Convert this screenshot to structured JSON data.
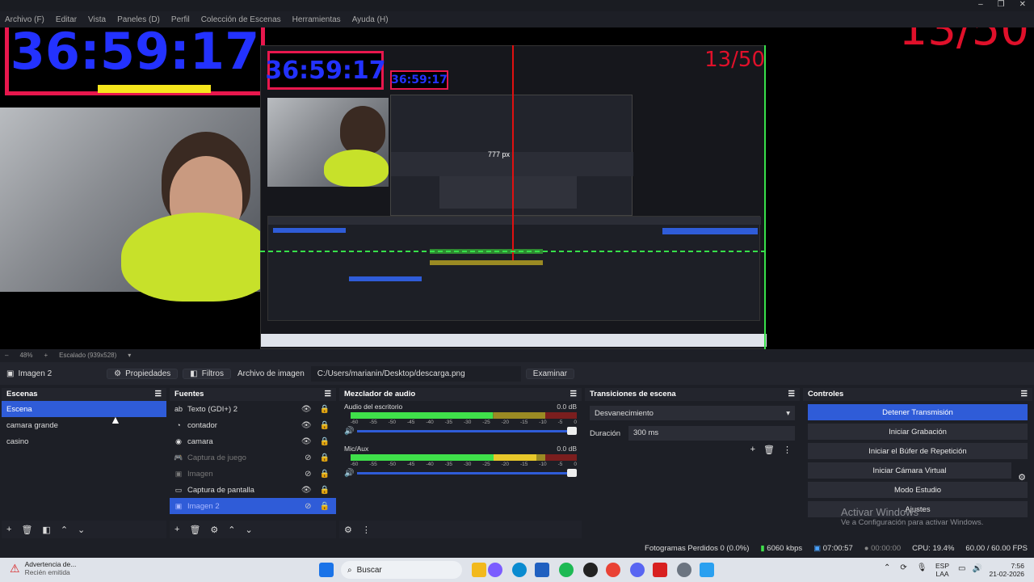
{
  "window": {
    "controls": [
      "–",
      "❐",
      "✕"
    ]
  },
  "menu": [
    "Archivo (F)",
    "Editar",
    "Vista",
    "Paneles (D)",
    "Perfil",
    "Colección de Escenas",
    "Herramientas",
    "Ayuda (H)"
  ],
  "preview": {
    "timer": "36:59:17",
    "timer_small": "36:59:17",
    "timer_tiny": "36:59:17",
    "counter": "13/50",
    "counter_inner": "13/50",
    "measure": "777 px",
    "colors": {
      "timer_text": "#2332ff",
      "timer_border": "#e8174d",
      "counter": "#e0102a",
      "guide": "#37e04a"
    }
  },
  "previewbar": {
    "zoom": "48%",
    "scale": "Escalado (939x528)"
  },
  "source_toolbar": {
    "source_name": "Imagen 2",
    "properties": "Propiedades",
    "filters": "Filtros",
    "image_file_label": "Archivo de imagen",
    "path": "C:/Users/marianin/Desktop/descarga.png",
    "browse": "Examinar"
  },
  "scenes": {
    "title": "Escenas",
    "items": [
      {
        "label": "Escena",
        "selected": true
      },
      {
        "label": "camara grande",
        "selected": false
      },
      {
        "label": "casino",
        "selected": false
      }
    ]
  },
  "sources": {
    "title": "Fuentes",
    "items": [
      {
        "label": "Texto (GDI+) 2",
        "icon": "text-icon",
        "visible": true,
        "selected": false
      },
      {
        "label": "contador",
        "icon": "clock-icon",
        "visible": true,
        "selected": false
      },
      {
        "label": "camara",
        "icon": "camera-icon",
        "visible": true,
        "selected": false
      },
      {
        "label": "Captura de juego",
        "icon": "gamepad-icon",
        "visible": false,
        "selected": false
      },
      {
        "label": "Imagen",
        "icon": "image-icon",
        "visible": false,
        "selected": false
      },
      {
        "label": "Captura de pantalla",
        "icon": "monitor-icon",
        "visible": true,
        "selected": false
      },
      {
        "label": "Imagen 2",
        "icon": "image-icon",
        "visible": false,
        "selected": true
      }
    ]
  },
  "mixer": {
    "title": "Mezclador de audio",
    "channels": [
      {
        "name": "Audio del escritorio",
        "db": "0.0 dB",
        "level": 0.63
      },
      {
        "name": "Mic/Aux",
        "db": "0.0 dB",
        "level": 0.82
      }
    ],
    "scale": [
      "-60",
      "-55",
      "-50",
      "-45",
      "-40",
      "-35",
      "-30",
      "-25",
      "-20",
      "-15",
      "-10",
      "-5",
      "0"
    ]
  },
  "transitions": {
    "title": "Transiciones de escena",
    "selected": "Desvanecimiento",
    "duration_label": "Duración",
    "duration_value": "300 ms"
  },
  "controls": {
    "title": "Controles",
    "buttons": [
      "Detener Transmisión",
      "Iniciar Grabación",
      "Iniciar el Búfer de Repetición",
      "Iniciar Cámara Virtual",
      "Modo Estudio",
      "Ajustes"
    ]
  },
  "watermark": {
    "line1": "Activar Windows",
    "line2": "Ve a Configuración para activar Windows."
  },
  "statusbar": {
    "dropped": "Fotogramas Perdidos 0 (0.0%)",
    "bitrate": "6060 kbps",
    "stream_time": "07:00:57",
    "rec_time": "00:00:00",
    "cpu": "CPU: 19.4%",
    "fps": "60.00 / 60.00 FPS"
  },
  "taskbar": {
    "notif_title": "Advertencia de...",
    "notif_sub": "Recién emitida",
    "search": "Buscar",
    "lang1": "ESP",
    "lang2": "LAA",
    "time": "7:56",
    "date": "21-02-2026"
  }
}
